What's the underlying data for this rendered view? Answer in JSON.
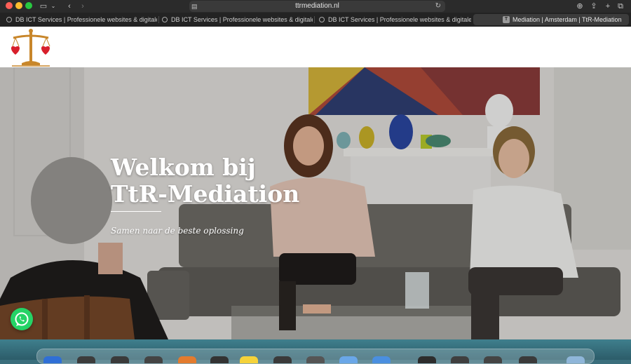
{
  "browser": {
    "url": "ttrmediation.nl",
    "tabs": [
      {
        "title": "DB ICT Services | Professionele websites & digitale onderst..."
      },
      {
        "title": "DB ICT Services | Professionele websites & digitale onderst..."
      },
      {
        "title": "DB ICT Services | Professionele websites & digitale onderst..."
      },
      {
        "title": "Mediation | Amsterdam | TtR-Mediation"
      }
    ],
    "active_tab_favicon": "T"
  },
  "hero": {
    "title": "Welkom bij TtR-Mediation",
    "subtitle": "Samen naar de beste oplossing"
  },
  "icons": {
    "logo": "scales-of-justice-with-hearts",
    "whatsapp": "whatsapp-icon"
  },
  "colors": {
    "whatsapp": "#25d366",
    "logo_gold": "#c8862a",
    "logo_heart": "#d81f2b"
  }
}
